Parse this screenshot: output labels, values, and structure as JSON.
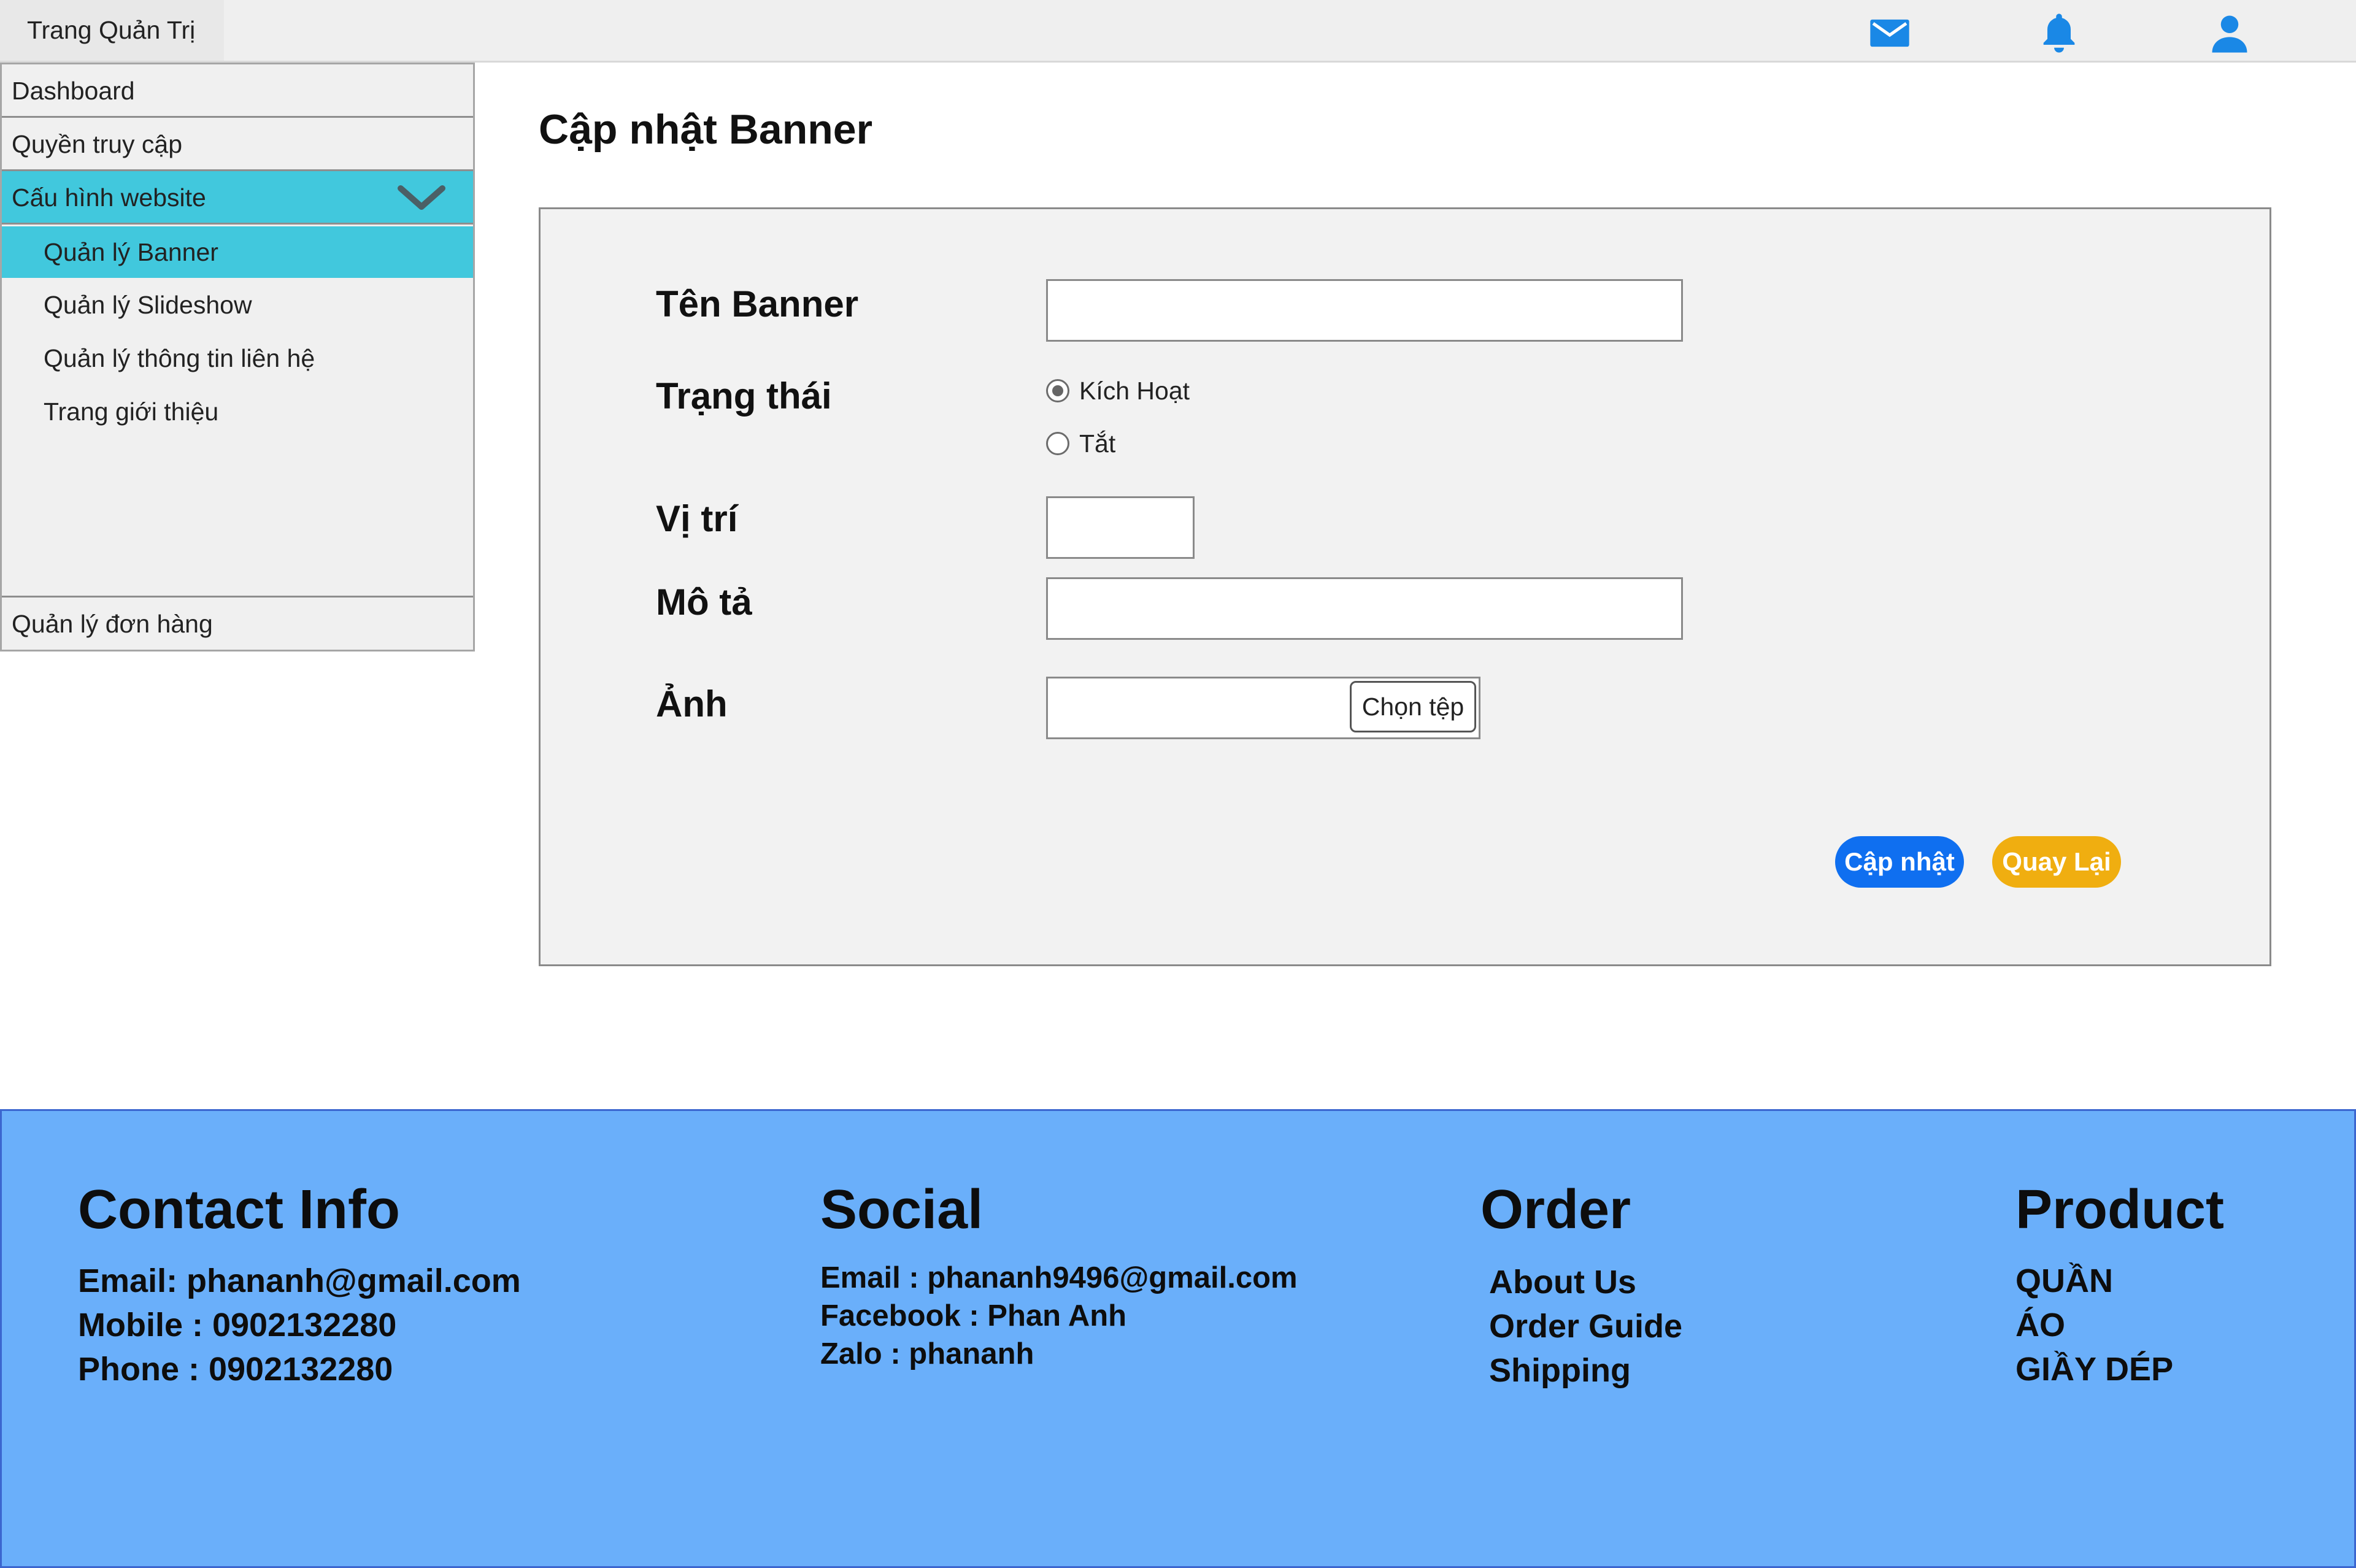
{
  "header": {
    "brand": "Trang Quản Trị",
    "icons": [
      "mail-icon",
      "bell-icon",
      "user-icon"
    ],
    "icon_color": "#1a88e6"
  },
  "sidebar": {
    "items": [
      {
        "label": "Dashboard"
      },
      {
        "label": "Quyền truy cập"
      },
      {
        "label": "Cấu hình website",
        "expanded": true,
        "active": true
      }
    ],
    "sub_items": [
      {
        "label": "Quản lý Banner",
        "active": true
      },
      {
        "label": "Quản lý Slideshow"
      },
      {
        "label": "Quản lý thông tin liên hệ"
      },
      {
        "label": "Trang giới thiệu"
      }
    ],
    "bottom_item": {
      "label": "Quản lý đơn hàng"
    },
    "active_color": "#41c8dd"
  },
  "main": {
    "title": "Cập nhật Banner",
    "form": {
      "name_label": "Tên Banner",
      "name_value": "",
      "status_label": "Trạng thái",
      "status_options": [
        {
          "label": "Kích Hoạt",
          "checked": true
        },
        {
          "label": "Tắt",
          "checked": false
        }
      ],
      "position_label": "Vị trí",
      "position_value": "",
      "description_label": "Mô tả",
      "description_value": "",
      "image_label": "Ảnh",
      "file_button": "Chọn tệp"
    },
    "buttons": {
      "update": "Cập nhật",
      "back": "Quay Lại",
      "update_color": "#0f6ff0",
      "back_color": "#f0ae10"
    }
  },
  "footer": {
    "background": "#6aaffa",
    "contact": {
      "title": "Contact Info",
      "email": "Email: phananh@gmail.com",
      "mobile": "Mobile : 0902132280",
      "phone": "Phone : 0902132280"
    },
    "social": {
      "title": "Social",
      "email": "Email : phananh9496@gmail.com",
      "facebook": "Facebook : Phan Anh",
      "zalo": "Zalo : phananh"
    },
    "order": {
      "title": "Order",
      "links": [
        "About Us",
        "Order Guide",
        "Shipping"
      ]
    },
    "product": {
      "title": "Product",
      "links": [
        "QUẦN",
        "ÁO",
        "GIẦY DÉP"
      ]
    }
  }
}
